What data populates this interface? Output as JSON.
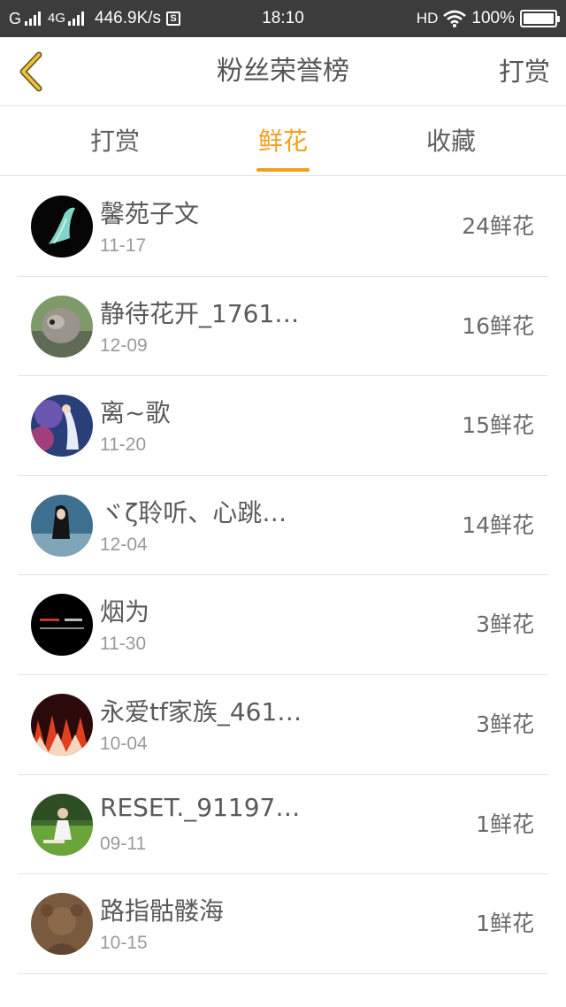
{
  "status_bar": {
    "carrier1": "G",
    "carrier2": "4G",
    "speed": "446.9K/s",
    "s_badge": "S",
    "time": "18:10",
    "hd": "HD",
    "battery_text": "100%",
    "battery_level": 1.0
  },
  "header": {
    "title": "粉丝荣誉榜",
    "back_icon": "chevron-left-icon",
    "right_action": "打赏",
    "accent_color": "#f0a01e"
  },
  "tabs": [
    {
      "label": "打赏",
      "active": false
    },
    {
      "label": "鲜花",
      "active": true
    },
    {
      "label": "收藏",
      "active": false
    }
  ],
  "fans": [
    {
      "name": "馨苑子文",
      "date": "11-17",
      "amount": "24鲜花"
    },
    {
      "name": "静待花开_1761…",
      "date": "12-09",
      "amount": "16鲜花"
    },
    {
      "name": "离~歌",
      "date": "11-20",
      "amount": "15鲜花"
    },
    {
      "name": "ヾζ聆听、心跳…",
      "date": "12-04",
      "amount": "14鲜花"
    },
    {
      "name": "烟为",
      "date": "11-30",
      "amount": "3鲜花"
    },
    {
      "name": "永爱tf家族_461…",
      "date": "10-04",
      "amount": "3鲜花"
    },
    {
      "name": "RESET._91197…",
      "date": "09-11",
      "amount": "1鲜花"
    },
    {
      "name": "路指骷髅海",
      "date": "10-15",
      "amount": "1鲜花"
    }
  ]
}
